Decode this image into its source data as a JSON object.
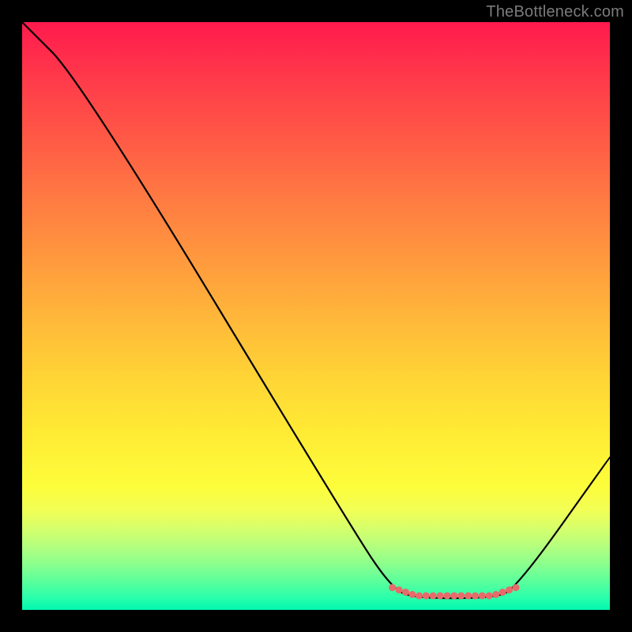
{
  "attribution": "TheBottleneck.com",
  "chart_data": {
    "type": "line",
    "title": "",
    "xlabel": "",
    "ylabel": "",
    "xlim": [
      0,
      100
    ],
    "ylim": [
      0,
      100
    ],
    "curve": [
      {
        "x": 0,
        "y": 100
      },
      {
        "x": 10,
        "y": 90
      },
      {
        "x": 56,
        "y": 14
      },
      {
        "x": 63,
        "y": 3.5
      },
      {
        "x": 67,
        "y": 2
      },
      {
        "x": 80,
        "y": 2
      },
      {
        "x": 84,
        "y": 3.5
      },
      {
        "x": 100,
        "y": 26
      }
    ],
    "dotted_segment": [
      {
        "x": 63,
        "y": 3.8
      },
      {
        "x": 67,
        "y": 2.4
      },
      {
        "x": 80,
        "y": 2.4
      },
      {
        "x": 84,
        "y": 3.8
      }
    ],
    "dot_color": "#e86a6a"
  }
}
